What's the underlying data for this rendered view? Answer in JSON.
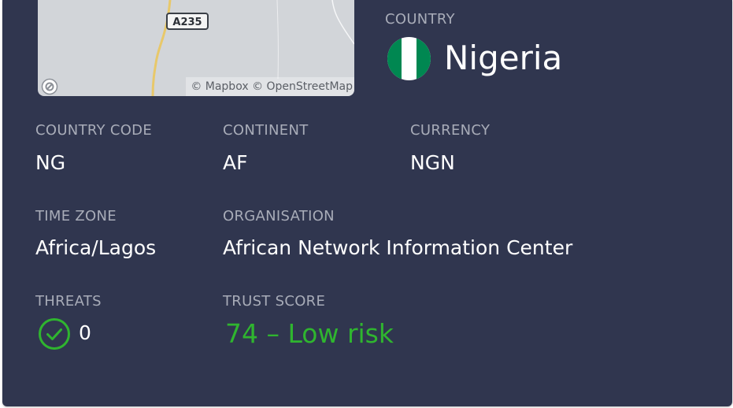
{
  "map": {
    "road_label": "A235",
    "attribution": "© Mapbox © OpenStreetMap",
    "background_color": "#d2d5d9",
    "road_color": "#e8c86a"
  },
  "country": {
    "label": "COUNTRY",
    "name": "Nigeria",
    "flag_icon": "nigeria-flag-icon",
    "flag_colors": {
      "green": "#008751",
      "white": "#ffffff"
    }
  },
  "fields": {
    "country_code": {
      "label": "COUNTRY CODE",
      "value": "NG"
    },
    "continent": {
      "label": "CONTINENT",
      "value": "AF"
    },
    "currency": {
      "label": "CURRENCY",
      "value": "NGN"
    },
    "time_zone": {
      "label": "TIME ZONE",
      "value": "Africa/Lagos"
    },
    "organisation": {
      "label": "ORGANISATION",
      "value": "African Network Information Center"
    },
    "threats": {
      "label": "THREATS",
      "value": "0",
      "icon": "check-circle-icon"
    },
    "trust_score": {
      "label": "TRUST SCORE",
      "value": "74 – Low risk"
    }
  },
  "colors": {
    "card_background": "#30364f",
    "label": "#a8acb8",
    "value": "#ffffff",
    "success_green": "#2fb52f"
  }
}
